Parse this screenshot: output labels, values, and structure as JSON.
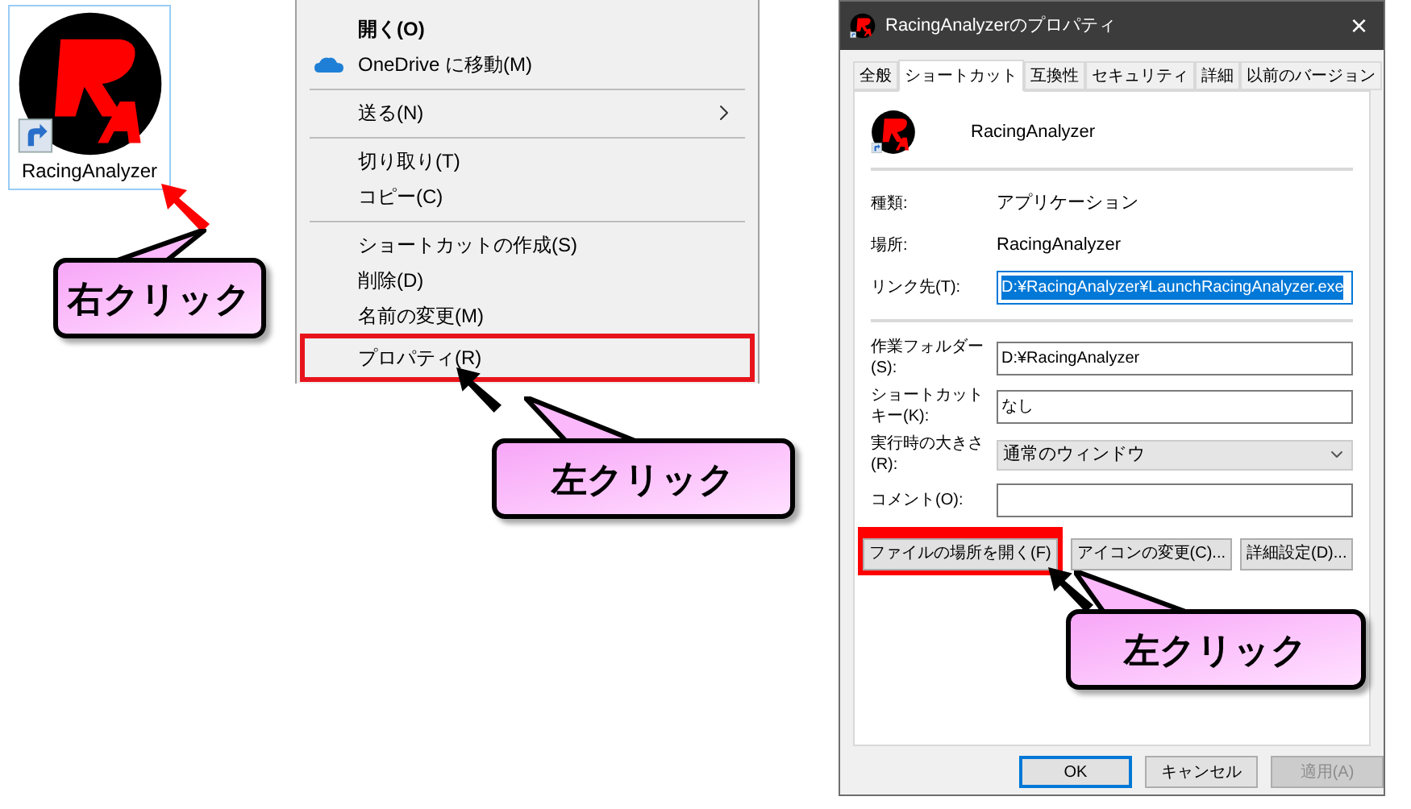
{
  "desktop_icon": {
    "label": "RacingAnalyzer",
    "selected": true
  },
  "context_menu": {
    "items": [
      {
        "kind": "item",
        "label": "開く(O)",
        "bold": true,
        "highlighted": false
      },
      {
        "kind": "cloud",
        "label": "OneDrive に移動(M)",
        "bold": false,
        "highlighted": false
      },
      {
        "kind": "separator"
      },
      {
        "kind": "submenu",
        "label": "送る(N)",
        "bold": false,
        "highlighted": false
      },
      {
        "kind": "separator"
      },
      {
        "kind": "item",
        "label": "切り取り(T)",
        "bold": false,
        "highlighted": false
      },
      {
        "kind": "item",
        "label": "コピー(C)",
        "bold": false,
        "highlighted": false
      },
      {
        "kind": "separator"
      },
      {
        "kind": "item",
        "label": "ショートカットの作成(S)",
        "bold": false,
        "highlighted": false
      },
      {
        "kind": "item",
        "label": "削除(D)",
        "bold": false,
        "highlighted": false
      },
      {
        "kind": "item",
        "label": "名前の変更(M)",
        "bold": false,
        "highlighted": false
      },
      {
        "kind": "item",
        "label": "プロパティ(R)",
        "bold": false,
        "highlighted": true
      }
    ]
  },
  "dialog": {
    "title": "RacingAnalyzerのプロパティ",
    "close": "×",
    "tabs": [
      {
        "label": "全般",
        "selected": false
      },
      {
        "label": "ショートカット",
        "selected": true
      },
      {
        "label": "互換性",
        "selected": false
      },
      {
        "label": "セキュリティ",
        "selected": false
      },
      {
        "label": "詳細",
        "selected": false
      },
      {
        "label": "以前のバージョン",
        "selected": false
      }
    ],
    "name": "RacingAnalyzer",
    "groups": [
      [
        {
          "kind": "text",
          "label": "種類:",
          "value": "アプリケーション"
        },
        {
          "kind": "text",
          "label": "場所:",
          "value": "RacingAnalyzer"
        },
        {
          "kind": "input",
          "label": "リンク先(T):",
          "value": "D:¥RacingAnalyzer¥LaunchRacingAnalyzer.exe",
          "value_selected": true
        }
      ],
      [
        {
          "kind": "input",
          "label": "作業フォルダー(S):",
          "value": "D:¥RacingAnalyzer",
          "value_selected": false
        },
        {
          "kind": "input",
          "label": "ショートカットキー(K):",
          "value": "なし",
          "value_selected": false
        },
        {
          "kind": "select",
          "label": "実行時の大きさ(R):",
          "value": "通常のウィンドウ"
        },
        {
          "kind": "input",
          "label": "コメント(O):",
          "value_selected": false
        }
      ]
    ],
    "buttons": [
      {
        "label": "ファイルの場所を開く(F)",
        "highlighted": true
      },
      {
        "label": "アイコンの変更(C)...",
        "highlighted": false
      },
      {
        "label": "詳細設定(D)...",
        "highlighted": false
      }
    ],
    "footer_buttons": [
      {
        "label": "OK",
        "default": true,
        "disabled": false
      },
      {
        "label": "キャンセル",
        "default": false,
        "disabled": false
      },
      {
        "label": "適用(A)",
        "default": false,
        "disabled": true
      }
    ]
  },
  "callouts": [
    {
      "text": "右クリック"
    },
    {
      "text": "左クリック"
    },
    {
      "text": "左クリック"
    }
  ]
}
